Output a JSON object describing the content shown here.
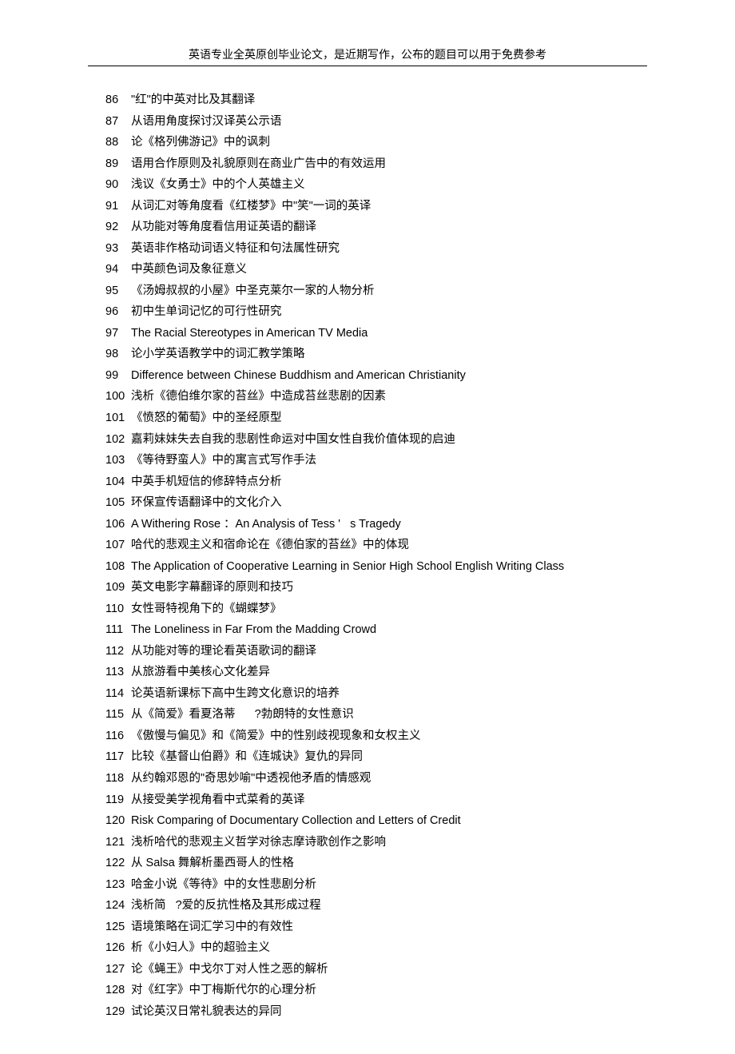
{
  "header": {
    "title": "英语专业全英原创毕业论文，是近期写作，公布的题目可以用于免费参考"
  },
  "items": [
    {
      "num": "86",
      "text": "\"红\"的中英对比及其翻译"
    },
    {
      "num": "87",
      "text": "从语用角度探讨汉译英公示语"
    },
    {
      "num": "88",
      "text": "论《格列佛游记》中的讽刺"
    },
    {
      "num": "89",
      "text": "语用合作原则及礼貌原则在商业广告中的有效运用"
    },
    {
      "num": "90",
      "text": "浅议《女勇士》中的个人英雄主义"
    },
    {
      "num": "91",
      "text": "从词汇对等角度看《红楼梦》中\"笑\"一词的英译"
    },
    {
      "num": "92",
      "text": "从功能对等角度看信用证英语的翻译"
    },
    {
      "num": "93",
      "text": "英语非作格动词语义特征和句法属性研究"
    },
    {
      "num": "94",
      "text": "中英颜色词及象征意义"
    },
    {
      "num": "95",
      "text": "《汤姆叔叔的小屋》中圣克莱尔一家的人物分析"
    },
    {
      "num": "96",
      "text": "初中生单词记忆的可行性研究"
    },
    {
      "num": "97",
      "text": "The Racial Stereotypes in American TV Media"
    },
    {
      "num": "98",
      "text": "论小学英语教学中的词汇教学策略"
    },
    {
      "num": "99",
      "text": "Difference between Chinese Buddhism and American Christianity"
    },
    {
      "num": "100",
      "text": "浅析《德伯维尔家的苔丝》中造成苔丝悲剧的因素"
    },
    {
      "num": "101",
      "text": "《愤怒的葡萄》中的圣经原型"
    },
    {
      "num": "102",
      "text": "嘉莉妹妹失去自我的悲剧性命运对中国女性自我价值体现的启迪"
    },
    {
      "num": "103",
      "text": "《等待野蛮人》中的寓言式写作手法"
    },
    {
      "num": "104",
      "text": "中英手机短信的修辞特点分析"
    },
    {
      "num": "105",
      "text": "环保宣传语翻译中的文化介入"
    },
    {
      "num": "106",
      "text": "A Withering Rose ：An Analysis of Tess '   s Tragedy"
    },
    {
      "num": "107",
      "text": "哈代的悲观主义和宿命论在《德伯家的苔丝》中的体现"
    },
    {
      "num": "108",
      "text": "The Application of Cooperative Learning in Senior High School English Writing Class"
    },
    {
      "num": "109",
      "text": "英文电影字幕翻译的原则和技巧"
    },
    {
      "num": "110",
      "text": "女性哥特视角下的《蝴蝶梦》"
    },
    {
      "num": "111",
      "text": "The Loneliness in Far From the Madding Crowd"
    },
    {
      "num": "112",
      "text": "从功能对等的理论看英语歌词的翻译"
    },
    {
      "num": "113",
      "text": "从旅游看中美核心文化差异"
    },
    {
      "num": "114",
      "text": "论英语新课标下高中生跨文化意识的培养"
    },
    {
      "num": "115",
      "text": "从《简爱》看夏洛蒂      ?勃朗特的女性意识"
    },
    {
      "num": "116",
      "text": "《傲慢与偏见》和《简爱》中的性别歧视现象和女权主义"
    },
    {
      "num": "117",
      "text": "比较《基督山伯爵》和《连城诀》复仇的异同"
    },
    {
      "num": "118",
      "text": "从约翰邓恩的\"奇思妙喻\"中透视他矛盾的情感观"
    },
    {
      "num": "119",
      "text": "从接受美学视角看中式菜肴的英译"
    },
    {
      "num": "120",
      "text": "Risk Comparing of Documentary Collection and Letters of Credit"
    },
    {
      "num": "121",
      "text": "浅析哈代的悲观主义哲学对徐志摩诗歌创作之影响"
    },
    {
      "num": "122",
      "text": "从 Salsa 舞解析墨西哥人的性格"
    },
    {
      "num": "123",
      "text": "哈金小说《等待》中的女性悲剧分析"
    },
    {
      "num": "124",
      "text": "浅析简   ?爱的反抗性格及其形成过程"
    },
    {
      "num": "125",
      "text": "语境策略在词汇学习中的有效性"
    },
    {
      "num": "126",
      "text": "析《小妇人》中的超验主义"
    },
    {
      "num": "127",
      "text": "论《蝇王》中戈尔丁对人性之恶的解析"
    },
    {
      "num": "128",
      "text": "对《红字》中丁梅斯代尔的心理分析"
    },
    {
      "num": "129",
      "text": "试论英汉日常礼貌表达的异同"
    }
  ]
}
